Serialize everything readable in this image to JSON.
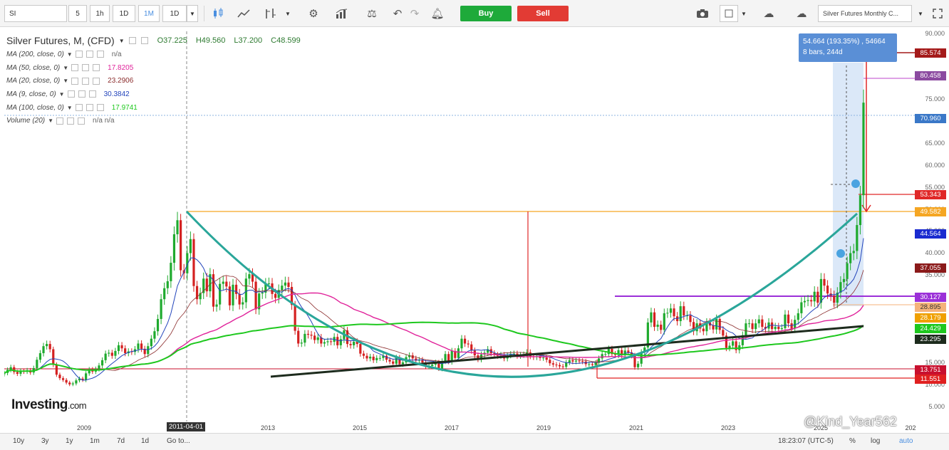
{
  "toolbar": {
    "symbol": "SI",
    "intervals": [
      {
        "label": "5",
        "active": false
      },
      {
        "label": "1h",
        "active": false
      },
      {
        "label": "1D",
        "active": false
      },
      {
        "label": "1M",
        "active": true
      }
    ],
    "interval_dropdown": "1D",
    "icons": [
      "candlestick-icon",
      "line-chart-icon",
      "drawing-tools-icon",
      "settings-icon",
      "indicators-icon",
      "compare-icon",
      "undo-icon",
      "redo-icon",
      "alert-icon"
    ],
    "buy_label": "Buy",
    "sell_label": "Sell",
    "layout_name": "Silver Futures Monthly C...",
    "colors": {
      "buy": "#1eaa3a",
      "sell": "#e23b34",
      "active": "#4a8fe0"
    }
  },
  "legend": {
    "title": "Silver Futures, M, (CFD)",
    "open": "O37.225",
    "high": "H49.560",
    "low": "L37.200",
    "close": "C48.599",
    "indicators": [
      {
        "label": "MA (200, close, 0)",
        "value": "n/a",
        "color": "#666666"
      },
      {
        "label": "MA (50, close, 0)",
        "value": "17.8205",
        "color": "#e0229a"
      },
      {
        "label": "MA (20, close, 0)",
        "value": "23.2906",
        "color": "#8b2d2d"
      },
      {
        "label": "MA (9, close, 0)",
        "value": "30.3842",
        "color": "#2244bb"
      },
      {
        "label": "MA (100, close, 0)",
        "value": "17.9741",
        "color": "#1ec81e"
      },
      {
        "label": "Volume (20)",
        "value": "n/a  n/a",
        "color": "#666666"
      }
    ]
  },
  "measure": {
    "line1": "54.664 (193.35%) , 54664",
    "line2": "8 bars, 244d"
  },
  "price_axis": {
    "ticks": [
      "90.000",
      "85.000",
      "80.000",
      "75.000",
      "70.000",
      "65.000",
      "60.000",
      "55.000",
      "50.000",
      "45.000",
      "40.000",
      "35.000",
      "30.000",
      "25.000",
      "20.000",
      "15.000",
      "10.000",
      "5.000"
    ],
    "labels": [
      {
        "text": "85.574",
        "color": "#a41a1a"
      },
      {
        "text": "80.458",
        "color": "#8b4aa0"
      },
      {
        "text": "70.960",
        "color": "#3a78c8"
      },
      {
        "text": "53.343",
        "color": "#e02828"
      },
      {
        "text": "49.582",
        "color": "#f5a623"
      },
      {
        "text": "44.564",
        "color": "#1a2bd0"
      },
      {
        "text": "37.055",
        "color": "#8b1a1a"
      },
      {
        "text": "30.127",
        "color": "#9b30d8"
      },
      {
        "text": "28.895",
        "color": "#f5b37a"
      },
      {
        "text": "28.179",
        "color": "#f0a000"
      },
      {
        "text": "24.429",
        "color": "#1ec81e"
      },
      {
        "text": "23.295",
        "color": "#1d2b1d"
      },
      {
        "text": "13.751",
        "color": "#c8102e"
      },
      {
        "text": "11.551",
        "color": "#e02020"
      }
    ]
  },
  "time_axis": {
    "labels": [
      "2009",
      "2011-04-01",
      "2013",
      "2015",
      "2017",
      "2019",
      "2021",
      "2023",
      "2025",
      "202"
    ]
  },
  "logo": {
    "brand": "Investing",
    "suffix": ".com"
  },
  "watermark": "@Kind_Year562",
  "bottom_bar": {
    "ranges": [
      "10y",
      "3y",
      "1y",
      "1m",
      "7d",
      "1d"
    ],
    "goto": "Go to...",
    "time": "18:23:07 (UTC-5)",
    "options": [
      "%",
      "log",
      "auto"
    ]
  },
  "chart_data": {
    "type": "candlestick",
    "title": "Silver Futures, M, (CFD)",
    "x_range": [
      "2008-01",
      "2025-12"
    ],
    "ylim": [
      5,
      90
    ],
    "log_scale": false,
    "grid": false,
    "close": [
      12.8,
      13.5,
      14.1,
      13.0,
      12.6,
      13.3,
      13.1,
      13.4,
      12.9,
      13.9,
      15.8,
      17.3,
      18.9,
      19.4,
      18.2,
      14.7,
      12.4,
      11.6,
      11.2,
      10.6,
      10.2,
      10.4,
      11.1,
      11.5,
      11.2,
      12.7,
      13.6,
      13.1,
      13.7,
      14.5,
      15.7,
      17.2,
      17.4,
      16.7,
      17.8,
      19.1,
      18.4,
      17.3,
      17.7,
      17.6,
      18.2,
      19.5,
      18.3,
      17.1,
      18.9,
      20.6,
      22.3,
      25.1,
      29.6,
      32.1,
      33.7,
      37.9,
      44.4,
      47.6,
      36.2,
      35.5,
      40.1,
      43.3,
      32.6,
      29.6,
      31.0,
      34.3,
      31.4,
      35.3,
      27.9,
      28.4,
      33.1,
      33.6,
      32.5,
      28.2,
      32.9,
      30.8,
      28.4,
      28.9,
      34.3,
      35.3,
      33.6,
      27.3,
      30.9,
      31.1,
      33.1,
      33.2,
      30.8,
      29.9,
      31.7,
      32.7,
      33.4,
      32.4,
      28.3,
      22.4,
      19.5,
      19.7,
      21.7,
      21.5,
      21.3,
      20.3,
      20.9,
      19.5,
      19.8,
      20.0,
      19.9,
      21.0,
      19.1,
      20.5,
      22.5,
      19.4,
      19.1,
      19.9,
      19.4,
      17.2,
      16.7,
      16.1,
      16.5,
      15.7,
      16.2,
      16.2,
      16.7,
      15.8,
      15.4,
      14.9,
      16.3,
      14.8,
      15.2,
      16.4,
      16.8,
      16.1,
      15.6,
      15.8,
      15.2,
      14.2,
      14.4,
      14.7,
      15.2,
      13.8,
      15.5,
      17.1,
      15.4,
      17.8,
      16.2,
      18.4,
      20.6,
      19.5,
      19.3,
      17.9,
      16.8,
      15.9,
      17.0,
      17.4,
      18.2,
      17.3,
      16.9,
      16.7,
      16.9,
      16.1,
      16.8,
      17.1,
      17.2,
      16.7,
      16.9,
      17.0,
      17.5,
      16.6,
      16.4,
      16.6,
      16.2,
      16.3,
      15.8,
      15.0,
      14.7,
      14.6,
      14.3,
      14.2,
      15.2,
      15.7,
      15.4,
      15.6,
      15.5,
      15.4,
      14.8,
      14.8,
      14.6,
      15.1,
      16.1,
      17.1,
      17.1,
      18.3,
      17.1,
      16.9,
      18.0,
      16.8,
      17.9,
      17.5,
      16.8,
      14.1,
      14.9,
      17.5,
      18.6,
      24.3,
      26.6,
      23.3,
      23.8,
      22.6,
      26.4,
      26.5,
      27.5,
      25.7,
      24.6,
      28.0,
      25.9,
      25.9,
      24.4,
      22.3,
      24.1,
      22.9,
      22.3,
      24.3,
      23.6,
      22.7,
      25.1,
      22.6,
      21.3,
      18.5,
      19.0,
      20.0,
      18.0,
      19.1,
      21.4,
      24.1,
      24.1,
      22.8,
      24.1,
      25.0,
      23.3,
      22.9,
      24.3,
      22.8,
      23.3,
      22.8,
      23.0,
      26.1,
      24.1,
      22.9,
      24.9,
      26.4,
      28.9,
      29.2,
      29.4,
      29.1,
      31.3,
      28.8,
      34.2,
      32.7,
      30.9,
      30.4,
      28.8,
      31.1,
      33.5,
      34.2,
      37.8,
      40.1,
      40.6,
      46.5,
      53.3,
      74.4
    ]
  }
}
